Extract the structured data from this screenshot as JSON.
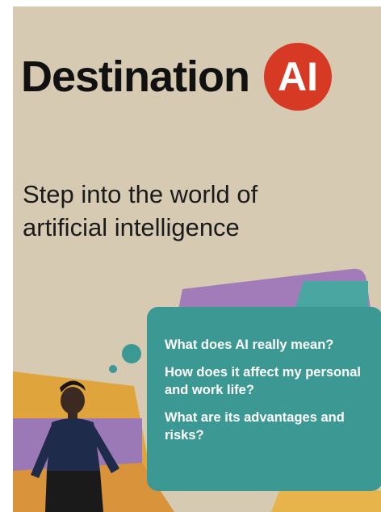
{
  "brand": {
    "word": "Destination",
    "badge": "AI",
    "badge_color": "#d63a24"
  },
  "tagline": {
    "line1": "Step into the world of",
    "line2": "artificial intelligence"
  },
  "questions": [
    "What does AI really mean?",
    "How does it affect my personal and work life?",
    "What are its advantages and risks?"
  ],
  "colors": {
    "background": "#d6cbb2",
    "card": "#3c9893",
    "accent_purple": "#9b78b6",
    "accent_orange": "#e0a43c"
  }
}
